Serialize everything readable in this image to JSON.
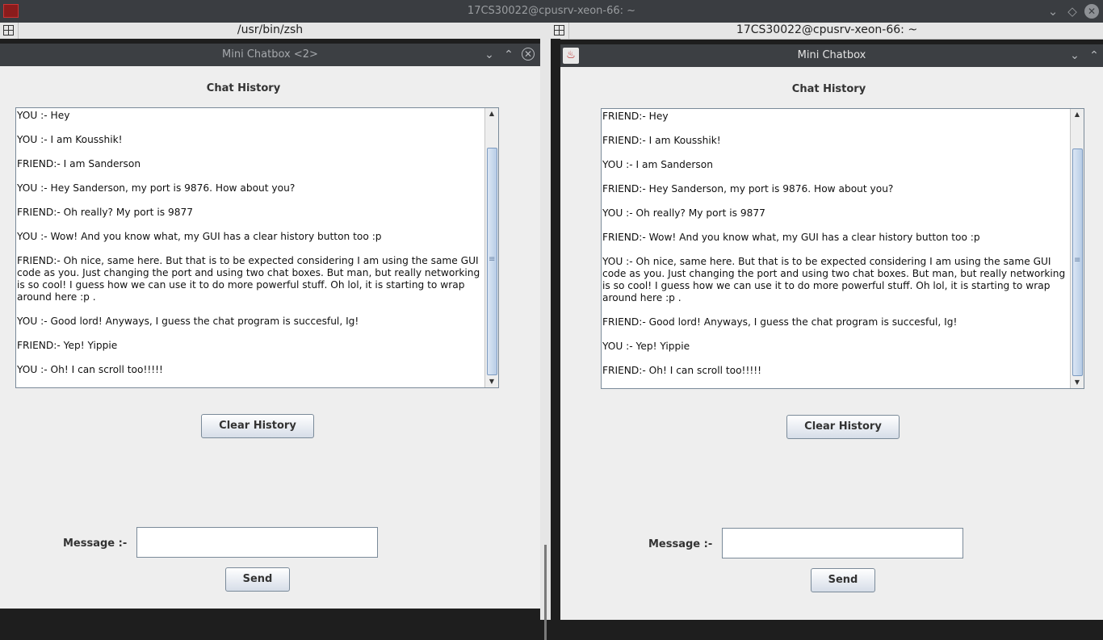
{
  "terminal": {
    "title": "17CS30022@cpusrv-xeon-66: ~",
    "left_pane_title": "/usr/bin/zsh",
    "right_pane_title": "17CS30022@cpusrv-xeon-66: ~"
  },
  "left_window": {
    "title": "Mini Chatbox <2>",
    "heading": "Chat History",
    "history": [
      "YOU :- Hey",
      "YOU :- I am Kousshik!",
      "FRIEND:- I am Sanderson",
      "YOU :- Hey Sanderson, my port is 9876. How about you?",
      "FRIEND:- Oh really? My port is 9877",
      "YOU :- Wow! And you know what, my GUI has a clear history button too :p",
      "FRIEND:- Oh nice, same here. But that is to be expected considering I am using the same GUI code as you. Just changing the port and using two chat boxes. But man, but really networking is so cool! I guess how we can use it to do more powerful stuff. Oh lol, it is starting to wrap around here :p .",
      "YOU :- Good lord! Anyways, I guess the chat program is succesful, Ig!",
      "FRIEND:- Yep! Yippie",
      "YOU :- Oh! I can scroll too!!!!!"
    ],
    "clear_label": "Clear History",
    "message_label": "Message :-",
    "message_value": "",
    "send_label": "Send"
  },
  "right_window": {
    "title": "Mini Chatbox",
    "heading": "Chat History",
    "history": [
      "FRIEND:- Hey",
      "FRIEND:- I am Kousshik!",
      "YOU :- I am Sanderson",
      "FRIEND:- Hey Sanderson, my port is 9876. How about you?",
      "YOU :- Oh really? My port is 9877",
      "FRIEND:- Wow! And you know what, my GUI has a clear history button too :p",
      "YOU :- Oh nice, same here. But that is to be expected considering I am using the same GUI code as you. Just changing the port and using two chat boxes. But man, but really networking is so cool! I guess how we can use it to do more powerful stuff. Oh lol, it is starting to wrap around here :p .",
      "FRIEND:- Good lord! Anyways, I guess the chat program is succesful, Ig!",
      "YOU :- Yep! Yippie",
      "FRIEND:- Oh! I can scroll too!!!!!"
    ],
    "clear_label": "Clear History",
    "message_label": "Message :-",
    "message_value": "",
    "send_label": "Send"
  },
  "colors": {
    "window_bg": "#eeeeee",
    "titlebar_bg": "#3c3f43",
    "terminal_bg": "#1e1e1e"
  },
  "icons": [
    "terminal-app-icon",
    "chevron-down-icon",
    "chevron-up-icon",
    "close-icon",
    "java-app-icon",
    "split-pane-icon"
  ]
}
